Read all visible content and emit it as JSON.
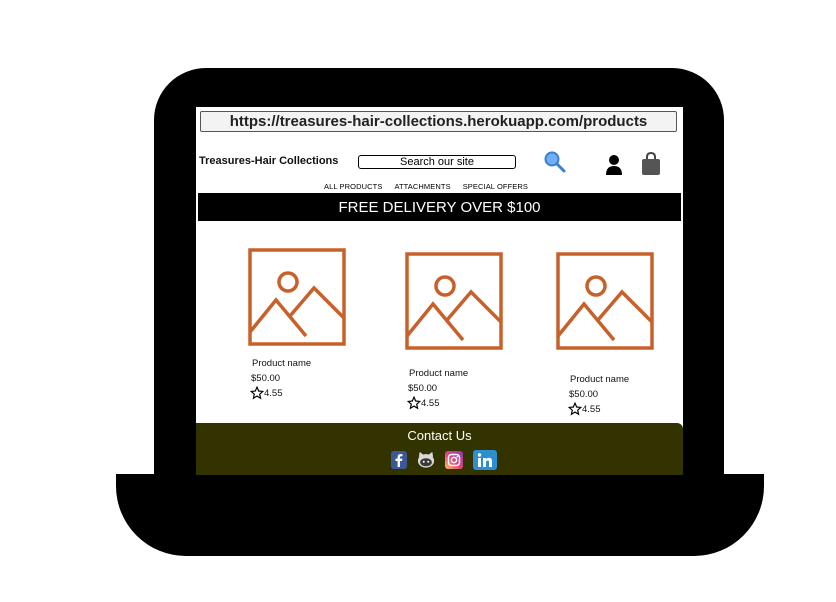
{
  "browser": {
    "url": "https://treasures-hair-collections.herokuapp.com/products"
  },
  "header": {
    "brand": "Treasures-Hair Collections",
    "search_label": "Search our site",
    "icons": [
      "search-icon",
      "user-icon",
      "shopping-bag-icon"
    ]
  },
  "nav": {
    "items": [
      "ALL PRODUCTS",
      "ATTACHMENTS",
      "SPECIAL OFFERS"
    ]
  },
  "banner": {
    "text": "FREE DELIVERY OVER $100"
  },
  "products": [
    {
      "name": "Product name",
      "price": "$50.00",
      "rating": "4.55"
    },
    {
      "name": "Product name",
      "price": "$50.00",
      "rating": "4.55"
    },
    {
      "name": "Product name",
      "price": "$50.00",
      "rating": "4.55"
    }
  ],
  "footer": {
    "title": "Contact Us",
    "socials": [
      "facebook-icon",
      "github-icon",
      "instagram-icon",
      "linkedin-icon"
    ]
  },
  "colors": {
    "image_placeholder": "#c8602a",
    "banner_bg": "#000000",
    "footer_bg": "#333300",
    "search_icon": "#4a8fe0"
  }
}
